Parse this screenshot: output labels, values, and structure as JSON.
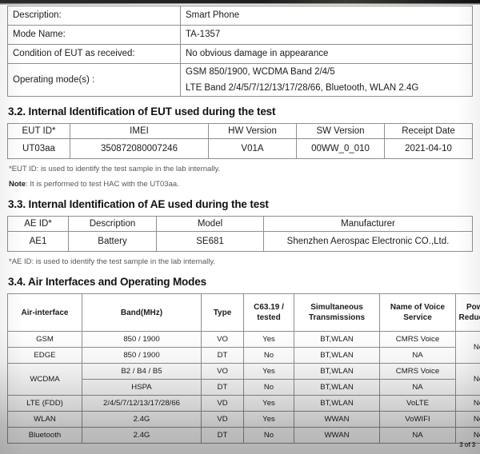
{
  "device_table": {
    "rows": [
      {
        "label": "Description:",
        "value": "Smart Phone"
      },
      {
        "label": "Mode Name:",
        "value": "TA-1357"
      },
      {
        "label": "Condition of EUT as received:",
        "value": "No obvious damage in appearance"
      }
    ],
    "operating_modes_label": "Operating mode(s) :",
    "operating_modes_line1": "GSM 850/1900, WCDMA Band 2/4/5",
    "operating_modes_line2": "LTE Band 2/4/5/7/12/13/17/28/66, Bluetooth, WLAN 2.4G"
  },
  "section_32": {
    "heading": "3.2. Internal Identification of EUT used during the test",
    "headers": [
      "EUT ID*",
      "IMEI",
      "HW Version",
      "SW Version",
      "Receipt Date"
    ],
    "rows": [
      [
        "UT03aa",
        "350872080007246",
        "V01A",
        "00WW_0_010",
        "2021-04-10"
      ]
    ],
    "footnote": "*EUT ID: is used to identify the test sample in the lab internally.",
    "note_label": "Note",
    "note_text": ": It is performed to test HAC with the UT03aa."
  },
  "section_33": {
    "heading": "3.3. Internal Identification of AE used during the test",
    "headers": [
      "AE ID*",
      "Description",
      "Model",
      "Manufacturer"
    ],
    "rows": [
      [
        "AE1",
        "Battery",
        "SE681",
        "Shenzhen Aerospac Electronic CO.,Ltd."
      ]
    ],
    "footnote": "*AE ID: is used to identify the test sample in the lab internally."
  },
  "section_34": {
    "heading": "3.4. Air Interfaces and Operating Modes",
    "headers": {
      "air_interface": "Air-interface",
      "band": "Band(MHz)",
      "type": "Type",
      "c63_line1": "C63.19 /",
      "c63_line2": "tested",
      "sim_line1": "Simultaneous",
      "sim_line2": "Transmissions",
      "voice_line1": "Name of Voice",
      "voice_line2": "Service",
      "power_line1": "Power",
      "power_line2": "Reduction"
    },
    "rows": [
      {
        "air_interface": "GSM",
        "band": "850 / 1900",
        "type": "VO",
        "c63": "Yes",
        "simultaneous": "BT,WLAN",
        "voice": "CMRS Voice",
        "power": "No"
      },
      {
        "air_interface": "EDGE",
        "band": "850 / 1900",
        "type": "DT",
        "c63": "No",
        "simultaneous": "BT,WLAN",
        "voice": "NA",
        "power": ""
      },
      {
        "air_interface": "WCDMA",
        "band": "B2 / B4 / B5",
        "type": "VO",
        "c63": "Yes",
        "simultaneous": "BT,WLAN",
        "voice": "CMRS Voice",
        "power": "No"
      },
      {
        "air_interface": "",
        "band": "HSPA",
        "type": "DT",
        "c63": "No",
        "simultaneous": "BT,WLAN",
        "voice": "NA",
        "power": ""
      },
      {
        "air_interface": "LTE (FDD)",
        "band": "2/4/5/7/12/13/17/28/66",
        "type": "VD",
        "c63": "Yes",
        "simultaneous": "BT,WLAN",
        "voice": "VoLTE",
        "power": "No"
      },
      {
        "air_interface": "WLAN",
        "band": "2.4G",
        "type": "VD",
        "c63": "Yes",
        "simultaneous": "WWAN",
        "voice": "VoWIFI",
        "power": "No"
      },
      {
        "air_interface": "Bluetooth",
        "band": "2.4G",
        "type": "DT",
        "c63": "No",
        "simultaneous": "WWAN",
        "voice": "NA",
        "power": "No"
      }
    ]
  },
  "page_marker": "3 of 3"
}
